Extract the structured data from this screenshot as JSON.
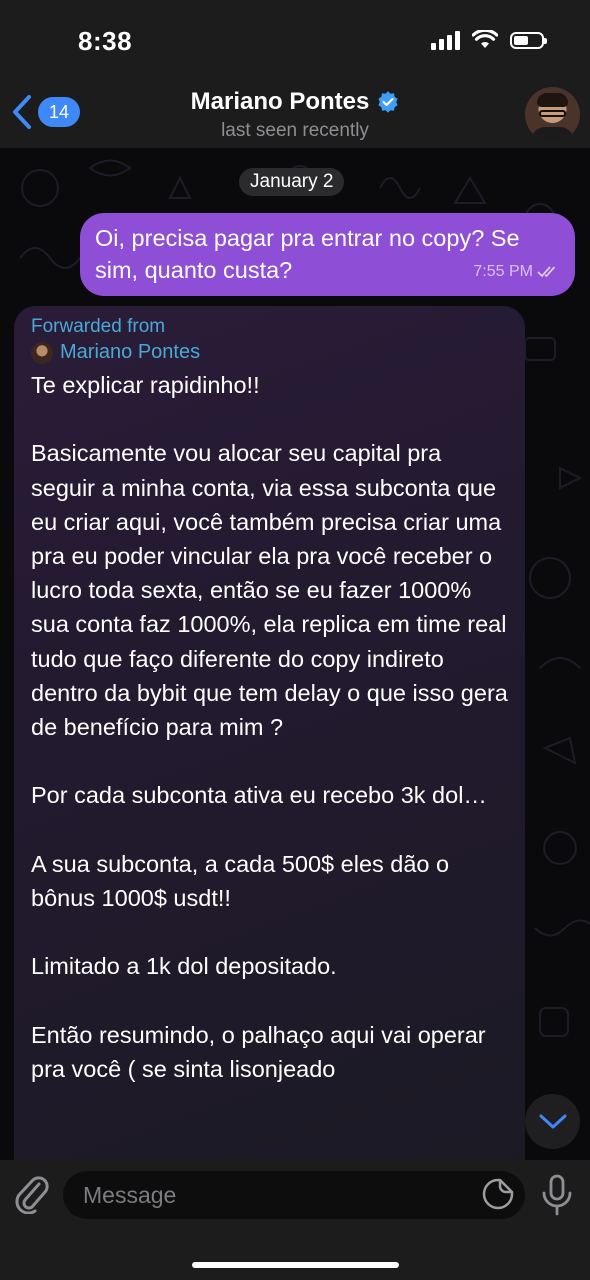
{
  "status_bar": {
    "time": "8:38"
  },
  "header": {
    "back_count": "14",
    "contact_name": "Mariano Pontes",
    "status": "last seen recently"
  },
  "chat": {
    "date": "January 2",
    "outgoing": {
      "text": "Oi, precisa pagar pra entrar no copy? Se sim, quanto custa?",
      "time": "7:55 PM"
    },
    "incoming": {
      "forwarded_label": "Forwarded from",
      "forwarded_name": "Mariano Pontes",
      "lines": [
        "Te explicar rapidinho!!",
        "",
        "Basicamente vou alocar seu capital pra seguir a minha conta, via essa subconta que eu criar aqui, você também precisa criar uma pra eu poder vincular ela pra você receber o lucro toda sexta, então se eu fazer 1000% sua conta faz 1000%, ela replica em time real tudo que faço diferente do copy indireto dentro da bybit que tem delay o que isso gera de benefício para mim ?",
        "",
        "Por cada subconta ativa eu recebo 3k dol…",
        "",
        "A sua subconta, a cada 500$ eles dão o bônus 1000$ usdt!!",
        "",
        "Limitado a 1k dol depositado.",
        "",
        "Então resumindo, o palhaço aqui vai operar pra você ( se sinta lisonjeado"
      ]
    }
  },
  "input": {
    "placeholder": "Message"
  },
  "colors": {
    "outgoing_bubble": "#8e4ed6",
    "accent_blue": "#3e88f7",
    "forward_link": "#4aa8d8"
  },
  "icons": [
    "back-chevron-icon",
    "verified-badge-icon",
    "double-check-icon",
    "chevron-down-icon",
    "paperclip-icon",
    "sticker-icon",
    "microphone-icon"
  ]
}
